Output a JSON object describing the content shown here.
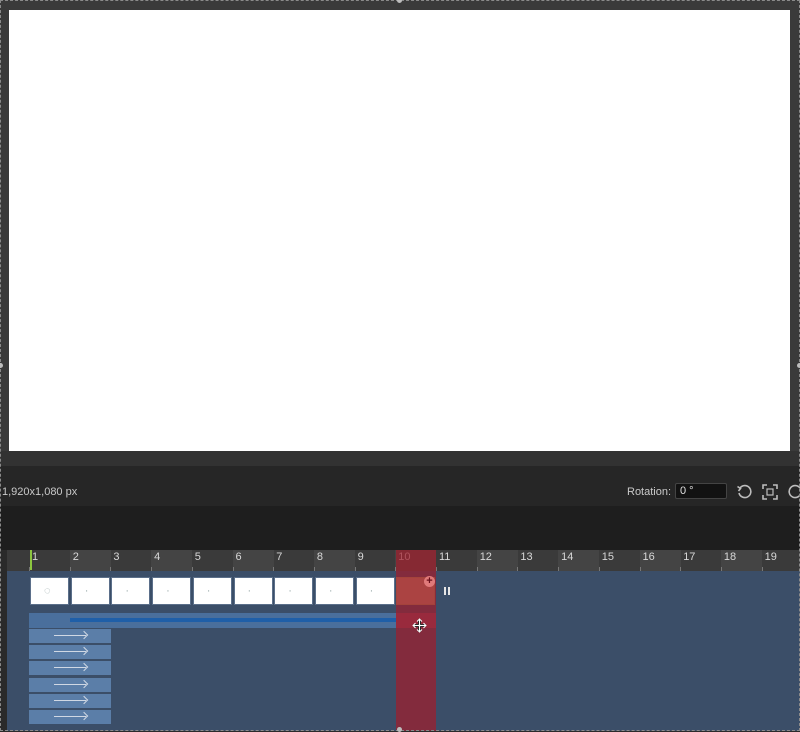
{
  "canvas": {
    "dimensions": "1,920x1,080 px"
  },
  "rotation": {
    "label": "Rotation:",
    "value": "0 °"
  },
  "icons": {
    "rotate_ccw": "rotate-ccw-icon",
    "fit": "fit-screen-icon",
    "rotate_cw": "rotate-cw-icon",
    "pause": "pause-icon",
    "add": "add-frame-icon",
    "move": "move-cursor-icon"
  },
  "timeline": {
    "ruler": [
      "1",
      "2",
      "3",
      "4",
      "5",
      "6",
      "7",
      "8",
      "9",
      "10",
      "11",
      "12",
      "13",
      "14",
      "15",
      "16",
      "17",
      "18",
      "19"
    ],
    "frames": [
      {
        "glyph": "◌"
      },
      {
        "glyph": "·"
      },
      {
        "glyph": "·"
      },
      {
        "glyph": "·"
      },
      {
        "glyph": "·"
      },
      {
        "glyph": "·"
      },
      {
        "glyph": "·"
      },
      {
        "glyph": "·"
      },
      {
        "glyph": "·"
      }
    ],
    "add_badge": "+",
    "layer_rows": 6
  },
  "colors": {
    "playhead": "#8cc63f",
    "current_frame": "#a01e2d",
    "track": "#3b4e68",
    "layer": "#5b7ea8"
  }
}
